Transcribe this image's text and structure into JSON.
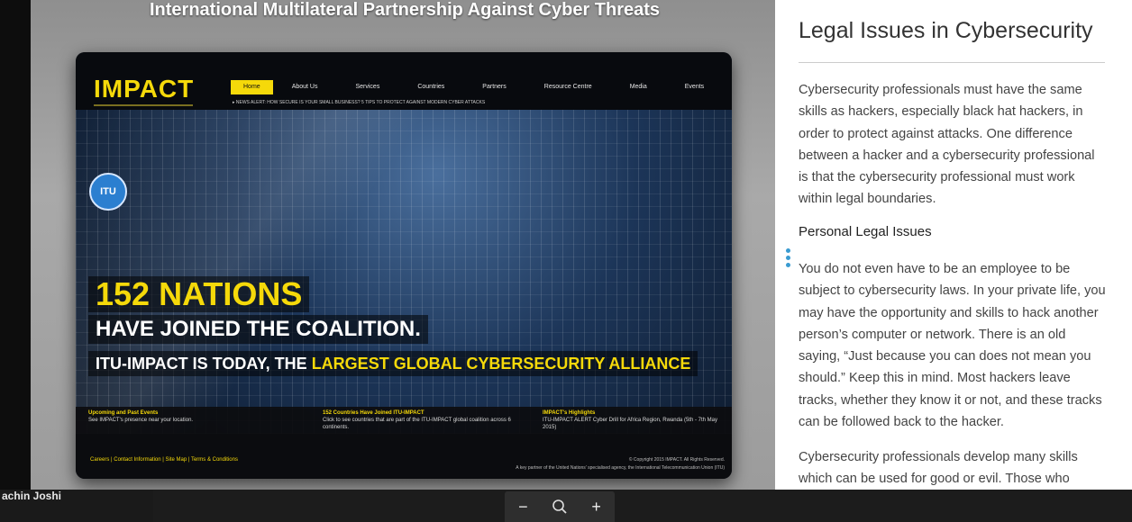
{
  "slide": {
    "title": "International Multilateral Partnership Against Cyber Threats",
    "site": {
      "logo": "IMPACT",
      "nav": [
        "Home",
        "About Us",
        "Services",
        "Countries",
        "Partners",
        "Resource Centre",
        "Media",
        "Events"
      ],
      "news": "▸ NEWS ALERT: HOW SECURE IS YOUR SMALL BUSINESS? 5 TIPS TO PROTECT AGAINST MODERN CYBER ATTACKS",
      "itu": "ITU",
      "headline_1": "152 NATIONS",
      "headline_2": "HAVE JOINED THE COALITION.",
      "headline_3a": "ITU-IMPACT IS TODAY, THE ",
      "headline_3b": "LARGEST GLOBAL CYBERSECURITY ALLIANCE",
      "footer": [
        {
          "title": "Upcoming and Past Events",
          "text": "See IMPACT's presence near your location."
        },
        {
          "title": "152 Countries Have Joined ITU-IMPACT",
          "text": "Click to see countries that are part of the ITU-IMPACT global coalition across 6 continents."
        },
        {
          "title": "IMPACT's Highlights",
          "text": "ITU-IMPACT ALERT Cyber Drill for Africa Region, Rwanda (5th - 7th May 2015)"
        }
      ],
      "footer_links": "Careers | Contact Information | Site Map | Terms & Conditions",
      "copyright": "© Copyright 2015 IMPACT. All Rights Reserved.",
      "partner_note": "A key partner of the United Nations' specialised agency, the International Telecommunication Union (ITU)"
    }
  },
  "panel": {
    "title": "Legal Issues in Cybersecurity",
    "p1": "Cybersecurity professionals must have the same skills as hackers, especially black hat hackers, in order to protect against attacks. One difference between a hacker and a cybersecurity professional is that the cybersecurity professional must work within legal boundaries.",
    "subheading": "Personal Legal Issues",
    "p2": "You do not even have to be an employee to be subject to cybersecurity laws. In your private life, you may have the opportunity and skills to hack another person’s computer or network. There is an old saying, “Just because you can does not mean you should.” Keep this in mind. Most hackers leave tracks, whether they know it or not, and these tracks can be followed back to the hacker.",
    "p3": "Cybersecurity professionals develop many skills which can be used for good or evil. Those who"
  },
  "bottom": {
    "participant_name": "achin Joshi",
    "zoom_out": "−",
    "zoom_reset_icon": "magnifier-icon",
    "zoom_in": "+"
  },
  "colors": {
    "accent_yellow": "#f5d90a",
    "panel_bg": "#ffffff",
    "drag_dots": "#3a9bd1"
  }
}
